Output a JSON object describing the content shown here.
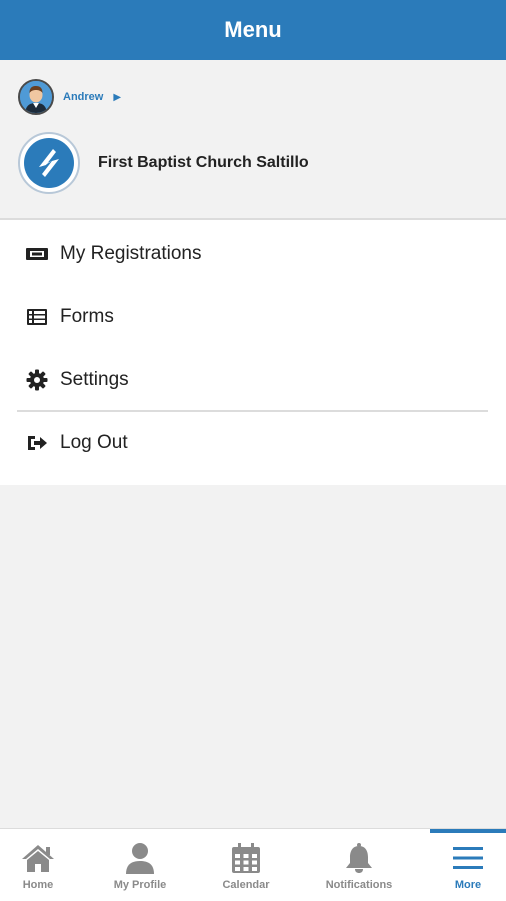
{
  "header": {
    "title": "Menu"
  },
  "account": {
    "user_name": "Andrew",
    "user_arrow": "▶",
    "org_name": "First Baptist Church Saltillo"
  },
  "menu": {
    "items": [
      {
        "label": "My Registrations",
        "icon": "ticket-icon"
      },
      {
        "label": "Forms",
        "icon": "list-icon"
      },
      {
        "label": "Settings",
        "icon": "gear-icon"
      },
      {
        "label": "Log Out",
        "icon": "sign-out-icon"
      }
    ]
  },
  "tabs": [
    {
      "label": "Home",
      "icon": "home-icon",
      "active": false
    },
    {
      "label": "My Profile",
      "icon": "user-icon",
      "active": false
    },
    {
      "label": "Calendar",
      "icon": "calendar-icon",
      "active": false
    },
    {
      "label": "Notifications",
      "icon": "bell-icon",
      "active": false
    },
    {
      "label": "More",
      "icon": "hamburger-icon",
      "active": true
    }
  ],
  "colors": {
    "primary": "#2b7bba",
    "background": "#f2f2f2",
    "inactive_tab": "#8a8a8a"
  }
}
